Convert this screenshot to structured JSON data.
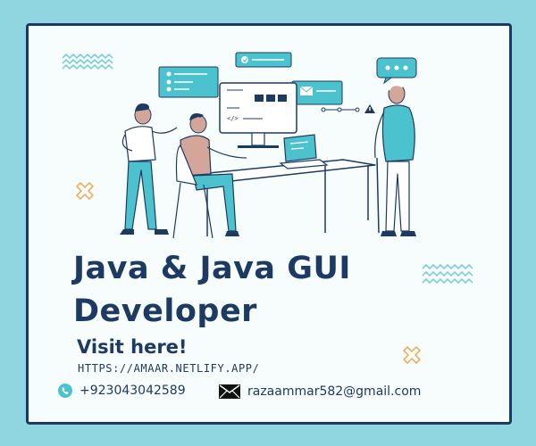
{
  "poster": {
    "title": "Java & Java GUI Developer",
    "visit_label": "Visit here!",
    "url": "HTTPS://AMAAR.NETLIFY.APP/",
    "phone": "+923043042589",
    "email": "razaammar582@gmail.com"
  },
  "colors": {
    "background": "#8fd6e1",
    "card": "#f7fcfd",
    "navy": "#1d3a63",
    "teal": "#4cc2cf",
    "orange": "#f0a64c"
  },
  "icons": [
    "phone-icon",
    "mail-icon",
    "zigzag-decoration",
    "cross-decoration",
    "chat-bubble-icon",
    "warning-icon"
  ]
}
